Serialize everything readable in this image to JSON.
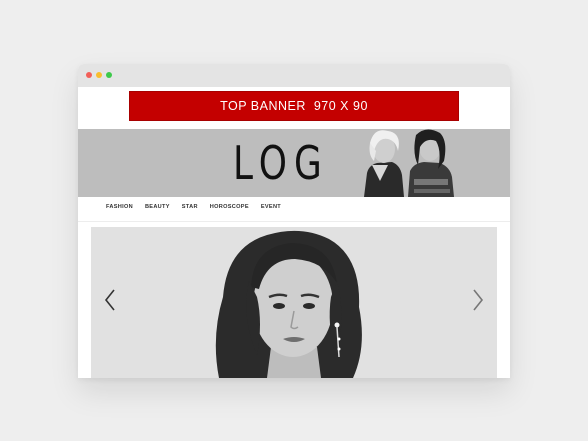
{
  "window": {
    "controls": [
      "close",
      "minimize",
      "maximize"
    ]
  },
  "banner": {
    "text": "TOP BANNER  970 X 90",
    "color": "#c40000"
  },
  "header": {
    "logo": "LOGO",
    "background": "#bdbdbd"
  },
  "nav": {
    "items": [
      {
        "label": "FASHION"
      },
      {
        "label": "BEAUTY"
      },
      {
        "label": "STAR"
      },
      {
        "label": "HOROSCOPE"
      },
      {
        "label": "EVENT"
      }
    ]
  },
  "hero": {
    "prev_icon": "chevron-left-icon",
    "next_icon": "chevron-right-icon"
  }
}
